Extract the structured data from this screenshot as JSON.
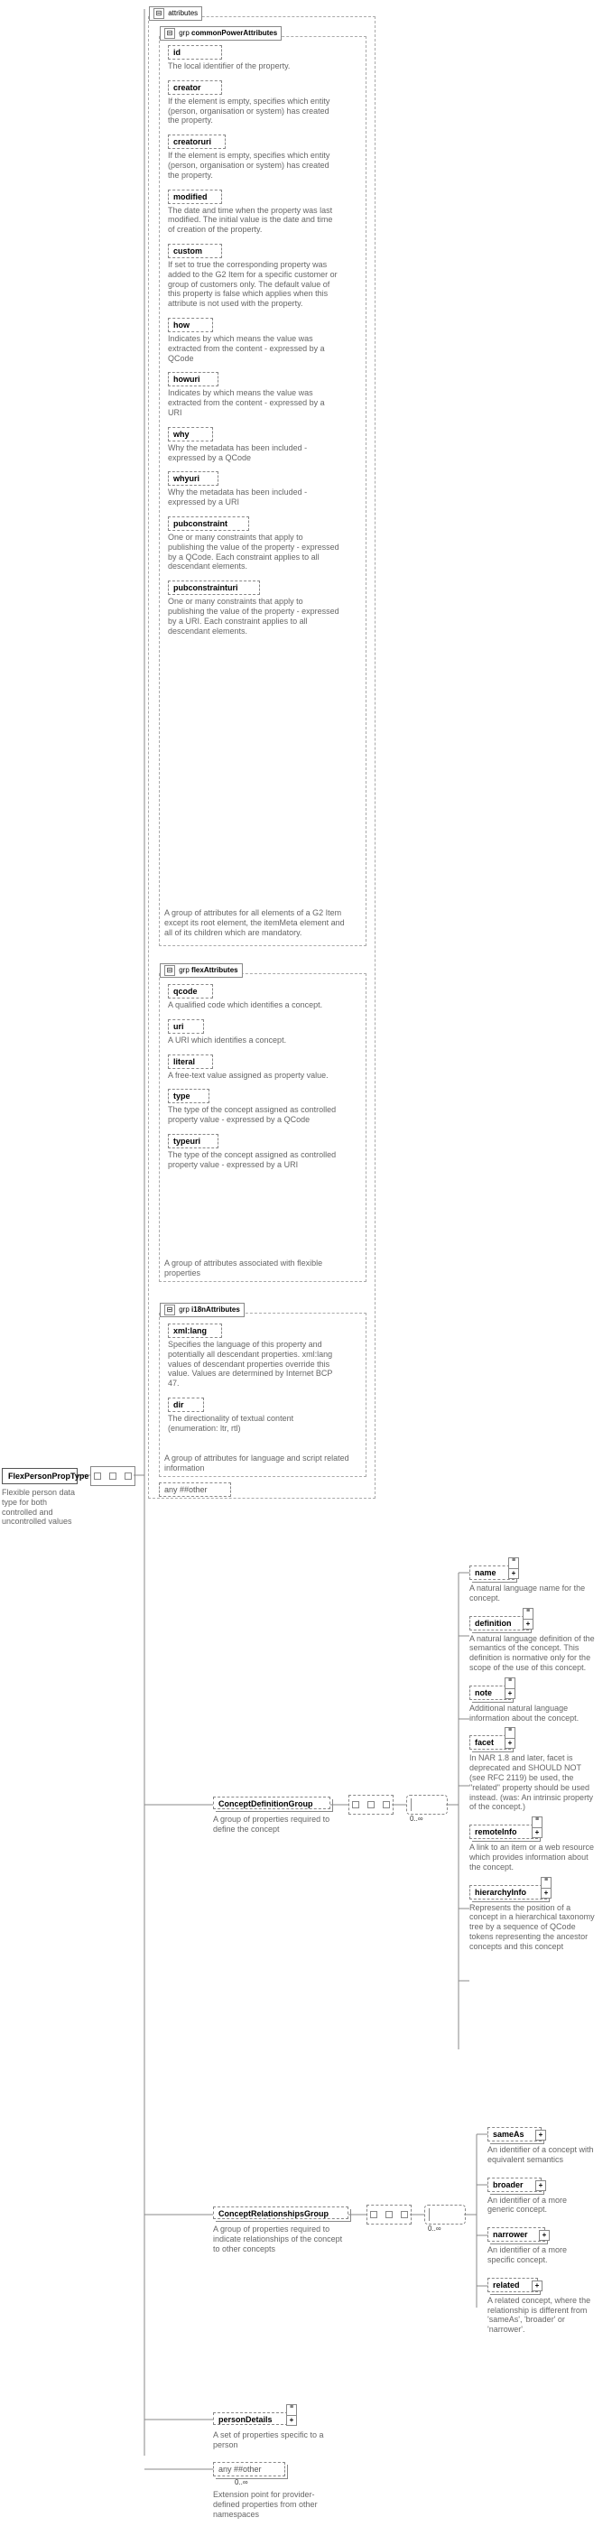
{
  "root": {
    "name": "FlexPersonPropType",
    "desc": "Flexible person data type for both controlled and uncontrolled values"
  },
  "attrFrame": {
    "tab": "attributes"
  },
  "grp1": {
    "label": "grp",
    "name": "commonPowerAttributes",
    "footer": "A group of attributes for all elements of a G2 Item except its root element, the itemMeta element and all of its children which are mandatory.",
    "items": [
      {
        "name": "id",
        "desc": "The local identifier of the property."
      },
      {
        "name": "creator",
        "desc": "If the element is empty, specifies which entity (person, organisation or system) has created the property."
      },
      {
        "name": "creatoruri",
        "desc": "If the element is empty, specifies which entity (person, organisation or system) has created the property."
      },
      {
        "name": "modified",
        "desc": "The date and time when the property was last modified. The initial value is the date and time of creation of the property."
      },
      {
        "name": "custom",
        "desc": "If set to true the corresponding property was added to the G2 Item for a specific customer or group of customers only. The default value of this property is false which applies when this attribute is not used with the property."
      },
      {
        "name": "how",
        "desc": "Indicates by which means the value was extracted from the content - expressed by a QCode"
      },
      {
        "name": "howuri",
        "desc": "Indicates by which means the value was extracted from the content - expressed by a URI"
      },
      {
        "name": "why",
        "desc": "Why the metadata has been included - expressed by a QCode"
      },
      {
        "name": "whyuri",
        "desc": "Why the metadata has been included - expressed by a URI"
      },
      {
        "name": "pubconstraint",
        "desc": "One or many constraints that apply to publishing the value of the property - expressed by a QCode. Each constraint applies to all descendant elements."
      },
      {
        "name": "pubconstrainturi",
        "desc": "One or many constraints that apply to publishing the value of the property - expressed by a URI. Each constraint applies to all descendant elements."
      }
    ]
  },
  "grp2": {
    "label": "grp",
    "name": "flexAttributes",
    "footer": "A group of attributes associated with flexible properties",
    "items": [
      {
        "name": "qcode",
        "desc": "A qualified code which identifies a concept."
      },
      {
        "name": "uri",
        "desc": "A URI which identifies a concept."
      },
      {
        "name": "literal",
        "desc": "A free-text value assigned as property value."
      },
      {
        "name": "type",
        "desc": "The type of the concept assigned as controlled property value - expressed by a QCode"
      },
      {
        "name": "typeuri",
        "desc": "The type of the concept assigned as controlled property value - expressed by a URI"
      }
    ]
  },
  "grp3": {
    "label": "grp",
    "name": "i18nAttributes",
    "footer": "A group of attributes for language and script related information",
    "items": [
      {
        "name": "xml:lang",
        "desc": "Specifies the language of this property and potentially all descendant properties. xml:lang values of descendant properties override this value. Values are determined by Internet BCP 47."
      },
      {
        "name": "dir",
        "desc": "The directionality of textual content (enumeration: ltr, rtl)"
      }
    ]
  },
  "anyOther": {
    "label": "any ##other"
  },
  "conceptDef": {
    "name": "ConceptDefinitionGroup",
    "desc": "A group of properties required to define the concept",
    "occur": "0..∞",
    "items": [
      {
        "name": "name",
        "desc": "A natural language name for the concept."
      },
      {
        "name": "definition",
        "desc": "A natural language definition of the semantics of the concept. This definition is normative only for the scope of the use of this concept."
      },
      {
        "name": "note",
        "desc": "Additional natural language information about the concept."
      },
      {
        "name": "facet",
        "desc": "In NAR 1.8 and later, facet is deprecated and SHOULD NOT (see RFC 2119) be used, the \"related\" property should be used instead. (was: An intrinsic property of the concept.)"
      },
      {
        "name": "remoteInfo",
        "desc": "A link to an item or a web resource which provides information about the concept."
      },
      {
        "name": "hierarchyInfo",
        "desc": "Represents the position of a concept in a hierarchical taxonomy tree by a sequence of QCode tokens representing the ancestor concepts and this concept"
      }
    ]
  },
  "conceptRel": {
    "name": "ConceptRelationshipsGroup",
    "desc": "A group of properties required to indicate relationships of the concept to other concepts",
    "occur": "0..∞",
    "items": [
      {
        "name": "sameAs",
        "desc": "An identifier of a concept with equivalent semantics"
      },
      {
        "name": "broader",
        "desc": "An identifier of a more generic concept."
      },
      {
        "name": "narrower",
        "desc": "An identifier of a more specific concept."
      },
      {
        "name": "related",
        "desc": "A related concept, where the relationship is different from 'sameAs', 'broader' or 'narrower'."
      }
    ]
  },
  "personDetails": {
    "name": "personDetails",
    "desc": "A set of properties specific to a person"
  },
  "extAny": {
    "label": "any ##other",
    "occur": "0..∞",
    "desc": "Extension point for provider-defined properties from other namespaces"
  }
}
